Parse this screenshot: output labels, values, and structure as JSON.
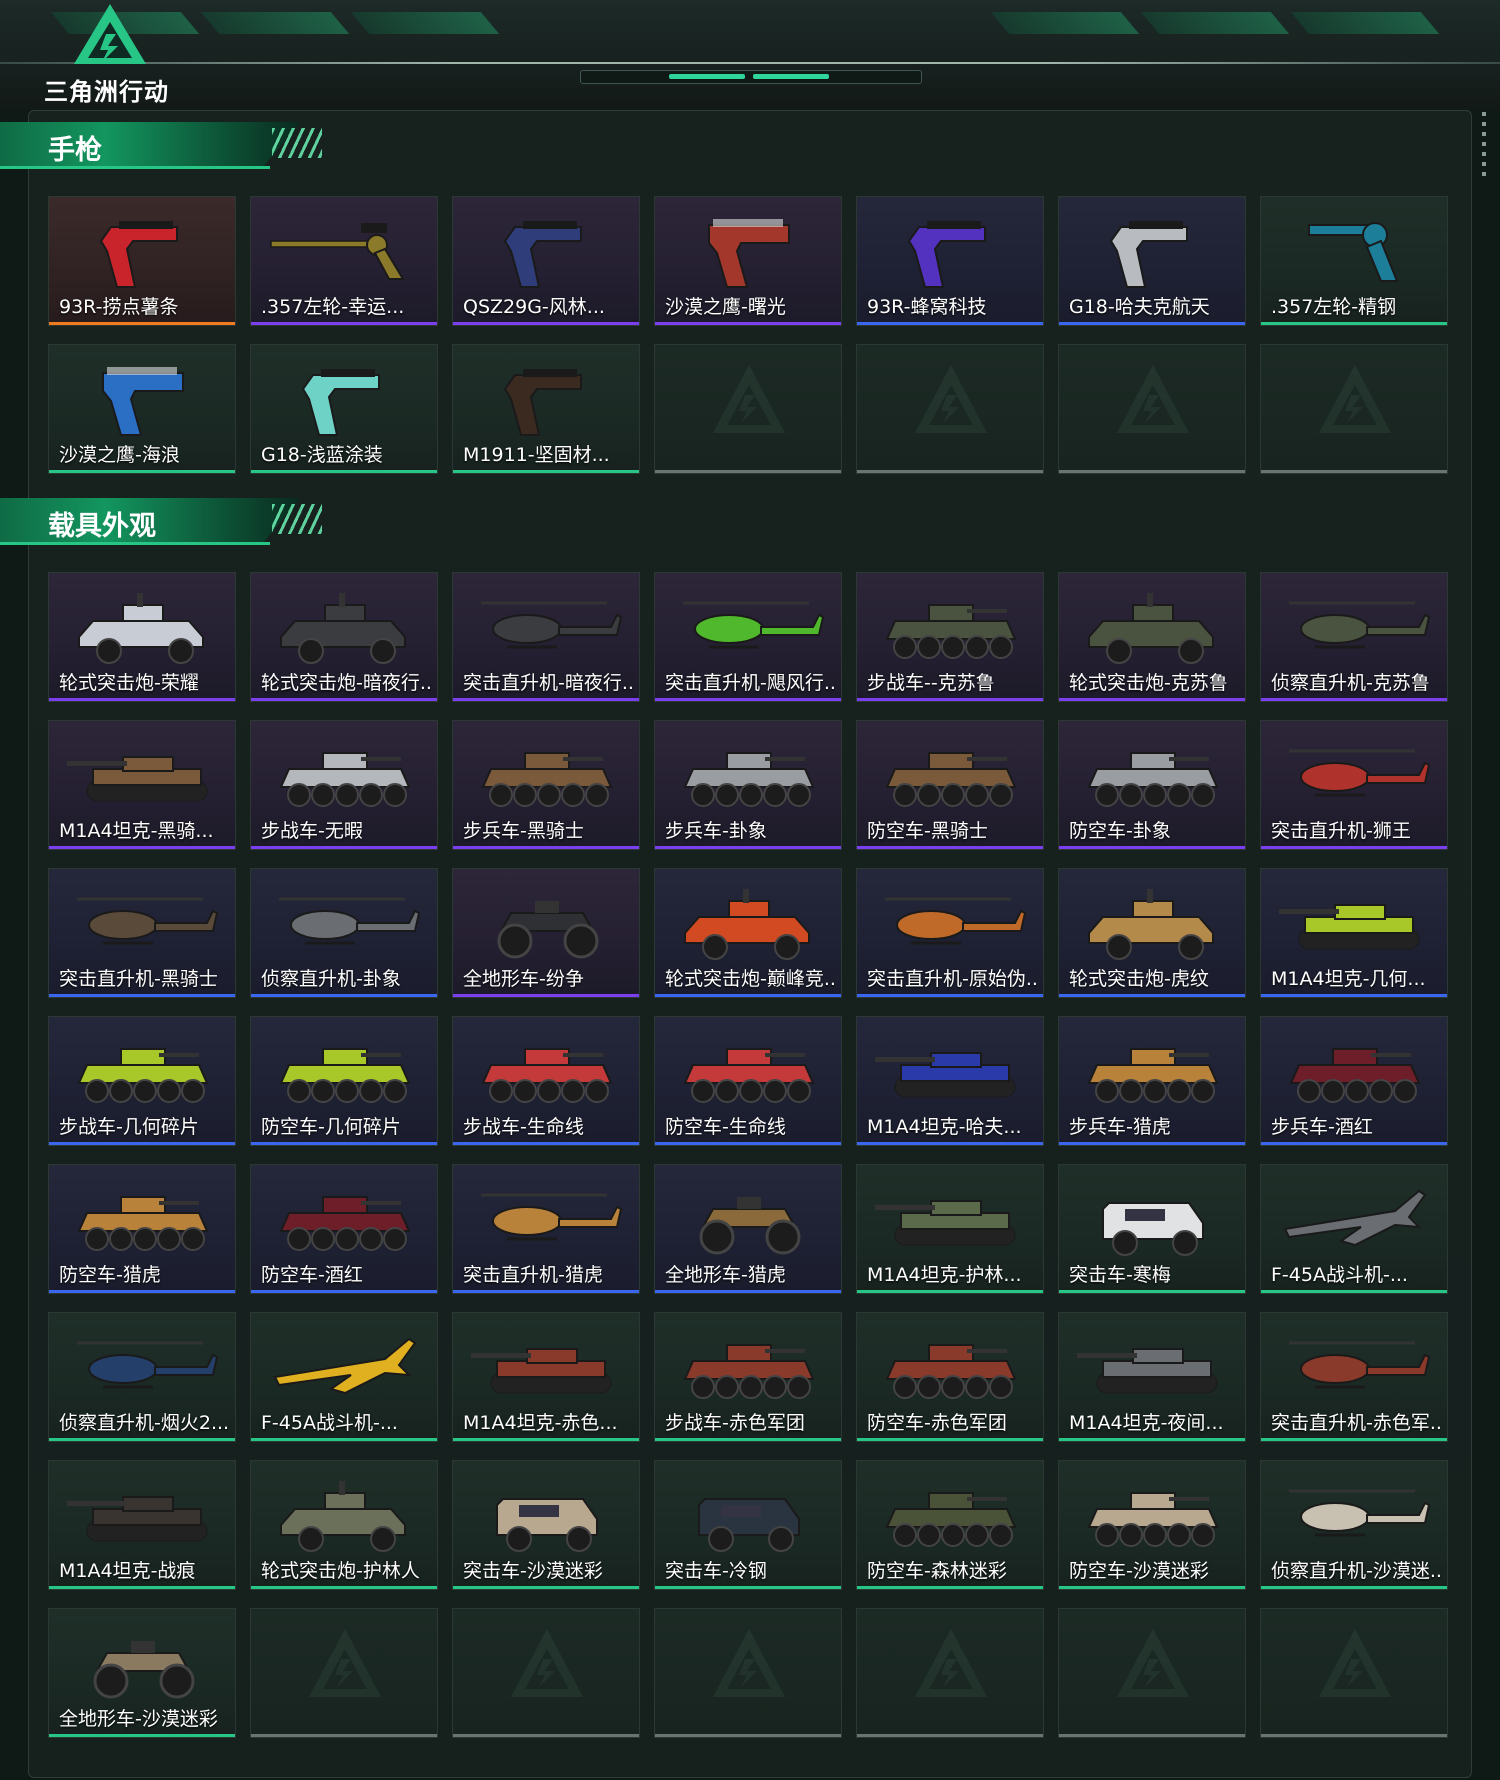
{
  "header": {
    "logo_text": "三角洲行动",
    "brand_color": "#27c687"
  },
  "sections": [
    {
      "title": "手枪",
      "items": [
        {
          "label": "93R-捞点薯条",
          "rarity": "orange",
          "kind": "pistol",
          "color": "#c9242b"
        },
        {
          "label": ".357左轮-幸运...",
          "rarity": "purple",
          "kind": "revolver-long",
          "color": "#8b7a2a"
        },
        {
          "label": "QSZ29G-风林...",
          "rarity": "purple",
          "kind": "pistol",
          "color": "#2f3e7a"
        },
        {
          "label": "沙漠之鹰-曙光",
          "rarity": "purple",
          "kind": "deagle",
          "color": "#a3372c"
        },
        {
          "label": "93R-蜂窝科技",
          "rarity": "blue",
          "kind": "pistol",
          "color": "#5432c0"
        },
        {
          "label": "G18-哈夫克航天",
          "rarity": "blue",
          "kind": "pistol",
          "color": "#b8bcc0"
        },
        {
          "label": ".357左轮-精钢",
          "rarity": "green",
          "kind": "revolver",
          "color": "#1d7e9a"
        },
        {
          "label": "沙漠之鹰-海浪",
          "rarity": "green",
          "kind": "deagle",
          "color": "#2a6fc4"
        },
        {
          "label": "G18-浅蓝涂装",
          "rarity": "green",
          "kind": "pistol",
          "color": "#6fd2c6"
        },
        {
          "label": "M1911-坚固材...",
          "rarity": "green",
          "kind": "pistol",
          "color": "#3a2a20"
        },
        {
          "label": "",
          "rarity": "empty"
        },
        {
          "label": "",
          "rarity": "empty"
        },
        {
          "label": "",
          "rarity": "empty"
        },
        {
          "label": "",
          "rarity": "empty"
        }
      ]
    },
    {
      "title": "载具外观",
      "items": [
        {
          "label": "轮式突击炮-荣耀",
          "rarity": "purple",
          "kind": "car",
          "color": "#c8ccd4"
        },
        {
          "label": "轮式突击炮-暗夜行...",
          "rarity": "purple",
          "kind": "car",
          "color": "#3a3c40"
        },
        {
          "label": "突击直升机-暗夜行...",
          "rarity": "purple",
          "kind": "heli",
          "color": "#3a3c40"
        },
        {
          "label": "突击直升机-飓风行...",
          "rarity": "purple",
          "kind": "heli",
          "color": "#4fb82c"
        },
        {
          "label": "步战车--克苏鲁",
          "rarity": "purple",
          "kind": "apc",
          "color": "#4a5240"
        },
        {
          "label": "轮式突击炮-克苏鲁",
          "rarity": "purple",
          "kind": "car",
          "color": "#4a5240"
        },
        {
          "label": "侦察直升机-克苏鲁",
          "rarity": "purple",
          "kind": "heli",
          "color": "#4a5240"
        },
        {
          "label": "M1A4坦克-黑骑...",
          "rarity": "purple",
          "kind": "tank",
          "color": "#7a5a3a"
        },
        {
          "label": "步战车-无暇",
          "rarity": "purple",
          "kind": "apc",
          "color": "#b4b8bc"
        },
        {
          "label": "步兵车-黑骑士",
          "rarity": "purple",
          "kind": "apc",
          "color": "#7a5a3a"
        },
        {
          "label": "步兵车-卦象",
          "rarity": "purple",
          "kind": "apc",
          "color": "#9a9ea2"
        },
        {
          "label": "防空车-黑骑士",
          "rarity": "purple",
          "kind": "apc",
          "color": "#7a5a3a"
        },
        {
          "label": "防空车-卦象",
          "rarity": "purple",
          "kind": "apc",
          "color": "#9a9ea2"
        },
        {
          "label": "突击直升机-狮王",
          "rarity": "purple",
          "kind": "heli",
          "color": "#b0322c"
        },
        {
          "label": "突击直升机-黑骑士",
          "rarity": "blue",
          "kind": "heli",
          "color": "#5a4a3a"
        },
        {
          "label": "侦察直升机-卦象",
          "rarity": "blue",
          "kind": "heli",
          "color": "#6a6e72"
        },
        {
          "label": "全地形车-纷争",
          "rarity": "purple",
          "kind": "atv",
          "color": "#2e3034"
        },
        {
          "label": "轮式突击炮-巅峰竞...",
          "rarity": "blue",
          "kind": "car",
          "color": "#d24a22"
        },
        {
          "label": "突击直升机-原始伪...",
          "rarity": "blue",
          "kind": "heli",
          "color": "#c06a2a"
        },
        {
          "label": "轮式突击炮-虎纹",
          "rarity": "blue",
          "kind": "car",
          "color": "#b48a4a"
        },
        {
          "label": "M1A4坦克-几何...",
          "rarity": "blue",
          "kind": "tank",
          "color": "#a8c82a"
        },
        {
          "label": "步战车-几何碎片",
          "rarity": "blue",
          "kind": "apc",
          "color": "#a8c82a"
        },
        {
          "label": "防空车-几何碎片",
          "rarity": "blue",
          "kind": "apc",
          "color": "#a8c82a"
        },
        {
          "label": "步战车-生命线",
          "rarity": "blue",
          "kind": "apc",
          "color": "#c43a3a"
        },
        {
          "label": "防空车-生命线",
          "rarity": "blue",
          "kind": "apc",
          "color": "#c43a3a"
        },
        {
          "label": "M1A4坦克-哈夫...",
          "rarity": "blue",
          "kind": "tank",
          "color": "#2a3aa8"
        },
        {
          "label": "步兵车-猎虎",
          "rarity": "blue",
          "kind": "apc",
          "color": "#b8823a"
        },
        {
          "label": "步兵车-酒红",
          "rarity": "blue",
          "kind": "apc",
          "color": "#6e1e28"
        },
        {
          "label": "防空车-猎虎",
          "rarity": "blue",
          "kind": "apc",
          "color": "#b8823a"
        },
        {
          "label": "防空车-酒红",
          "rarity": "blue",
          "kind": "apc",
          "color": "#6e1e28"
        },
        {
          "label": "突击直升机-猎虎",
          "rarity": "blue",
          "kind": "heli",
          "color": "#b8823a"
        },
        {
          "label": "全地形车-猎虎",
          "rarity": "blue",
          "kind": "atv",
          "color": "#8a6a3a"
        },
        {
          "label": "M1A4坦克-护林...",
          "rarity": "green",
          "kind": "tank",
          "color": "#5a6a4a"
        },
        {
          "label": "突击车-寒梅",
          "rarity": "green",
          "kind": "truck",
          "color": "#e0e2e4"
        },
        {
          "label": "F-45A战斗机-...",
          "rarity": "green",
          "kind": "jet",
          "color": "#6a6e72"
        },
        {
          "label": "侦察直升机-烟火2...",
          "rarity": "green",
          "kind": "heli",
          "color": "#24406a"
        },
        {
          "label": "F-45A战斗机-...",
          "rarity": "green",
          "kind": "jet",
          "color": "#e0b020"
        },
        {
          "label": "M1A4坦克-赤色...",
          "rarity": "green",
          "kind": "tank",
          "color": "#8a3a2a"
        },
        {
          "label": "步战车-赤色军团",
          "rarity": "green",
          "kind": "apc",
          "color": "#8a3a2a"
        },
        {
          "label": "防空车-赤色军团",
          "rarity": "green",
          "kind": "apc",
          "color": "#8a3a2a"
        },
        {
          "label": "M1A4坦克-夜间...",
          "rarity": "green",
          "kind": "tank",
          "color": "#6a6e72"
        },
        {
          "label": "突击直升机-赤色军...",
          "rarity": "green",
          "kind": "heli",
          "color": "#8a3a2a"
        },
        {
          "label": "M1A4坦克-战痕",
          "rarity": "green",
          "kind": "tank",
          "color": "#3a3430"
        },
        {
          "label": "轮式突击炮-护林人",
          "rarity": "green",
          "kind": "car",
          "color": "#6a705a"
        },
        {
          "label": "突击车-沙漠迷彩",
          "rarity": "green",
          "kind": "truck",
          "color": "#b8a890"
        },
        {
          "label": "突击车-冷钢",
          "rarity": "green",
          "kind": "truck",
          "color": "#2a3440"
        },
        {
          "label": "防空车-森林迷彩",
          "rarity": "green",
          "kind": "apc",
          "color": "#4a5238"
        },
        {
          "label": "防空车-沙漠迷彩",
          "rarity": "green",
          "kind": "apc",
          "color": "#b8a890"
        },
        {
          "label": "侦察直升机-沙漠迷...",
          "rarity": "green",
          "kind": "heli",
          "color": "#c8c0b0"
        },
        {
          "label": "全地形车-沙漠迷彩",
          "rarity": "green",
          "kind": "atv",
          "color": "#8a7a60"
        },
        {
          "label": "",
          "rarity": "empty"
        },
        {
          "label": "",
          "rarity": "empty"
        },
        {
          "label": "",
          "rarity": "empty"
        },
        {
          "label": "",
          "rarity": "empty"
        },
        {
          "label": "",
          "rarity": "empty"
        },
        {
          "label": "",
          "rarity": "empty"
        }
      ]
    }
  ]
}
